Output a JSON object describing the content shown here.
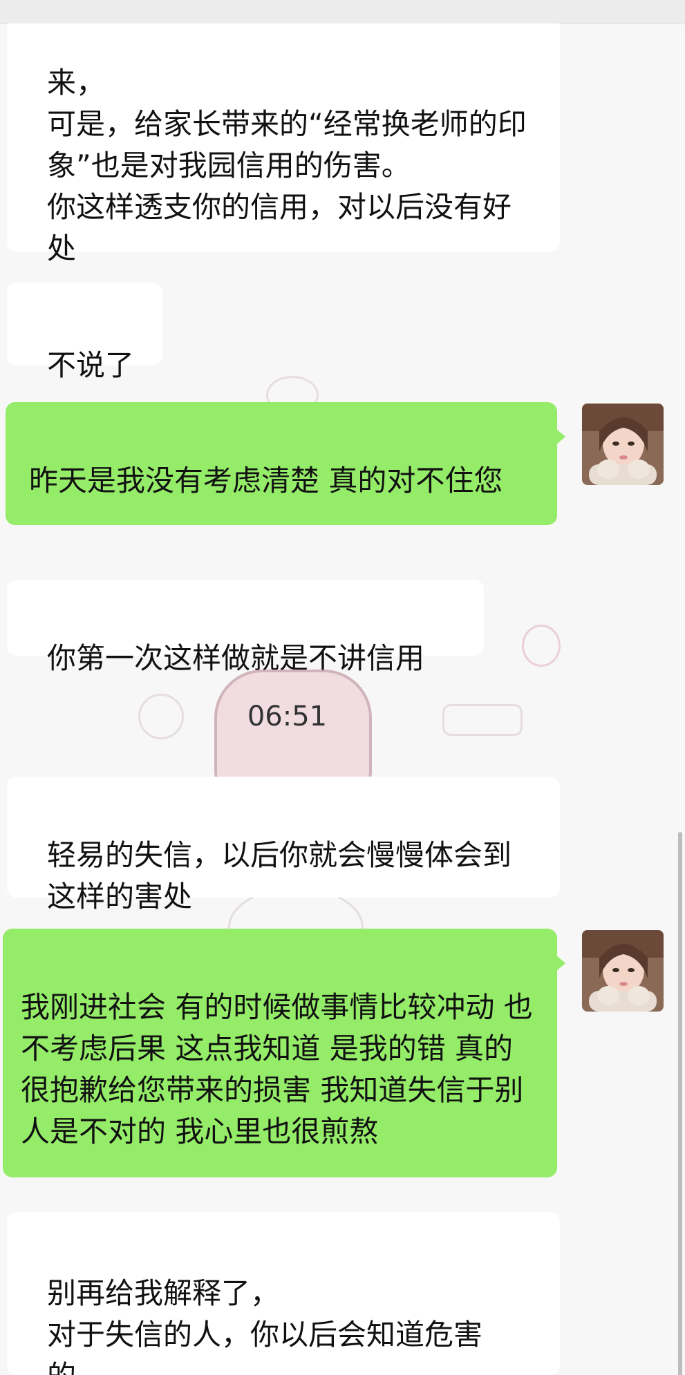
{
  "messages": [
    {
      "side": "incoming",
      "text": "来，\n可是，给家长带来的“经常换老师的印象”也是对我园信用的伤害。\n你这样透支你的信用，对以后没有好处"
    },
    {
      "side": "incoming",
      "text": "不说了"
    },
    {
      "side": "outgoing",
      "text": "昨天是我没有考虑清楚 真的对不住您"
    },
    {
      "side": "incoming",
      "text": "你第一次这样做就是不讲信用"
    },
    {
      "side": "incoming",
      "text": "轻易的失信，以后你就会慢慢体会到这样的害处"
    },
    {
      "side": "outgoing",
      "text": "我刚进社会 有的时候做事情比较冲动 也不考虑后果 这点我知道 是我的错 真的很抱歉给您带来的损害 我知道失信于别人是不对的 我心里也很煎熬"
    },
    {
      "side": "incoming",
      "text": "别再给我解释了，\n对于失信的人，你以后会知道危害的。"
    }
  ],
  "timestamp": "06:51",
  "colors": {
    "outgoing_bubble": "#95ec69",
    "incoming_bubble": "#ffffff",
    "background": "#f6f7f6"
  },
  "icons": {
    "avatar": "user-avatar"
  }
}
